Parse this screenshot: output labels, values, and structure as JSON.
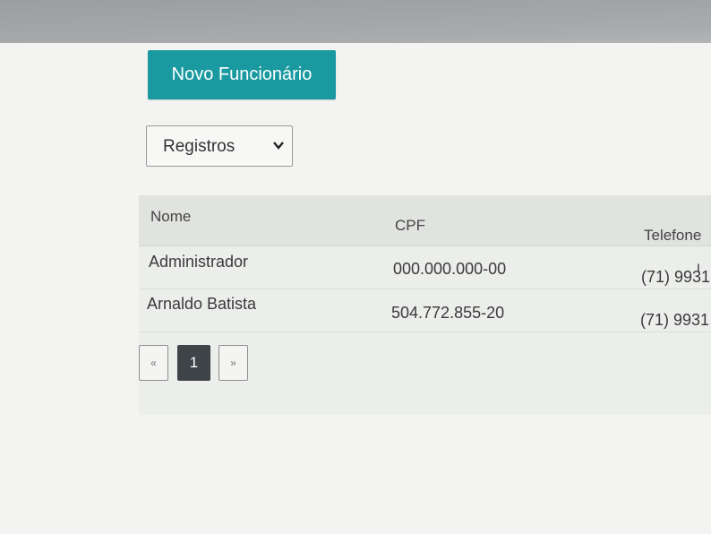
{
  "toolbar": {
    "new_employee_label": "Novo Funcionário"
  },
  "filter": {
    "selected": "Registros"
  },
  "table": {
    "headers": [
      "Nome",
      "CPF",
      "Telefone"
    ],
    "rows": [
      [
        "Administrador",
        "000.000.000-00",
        "(71) 9931"
      ],
      [
        "Arnaldo Batista",
        "504.772.855-20",
        "(71) 9931"
      ]
    ]
  },
  "pagination": {
    "prev": "«",
    "current": "1",
    "next": "»"
  },
  "colors": {
    "primary_button": "#1a9aa0",
    "active_page": "#3f4448"
  }
}
